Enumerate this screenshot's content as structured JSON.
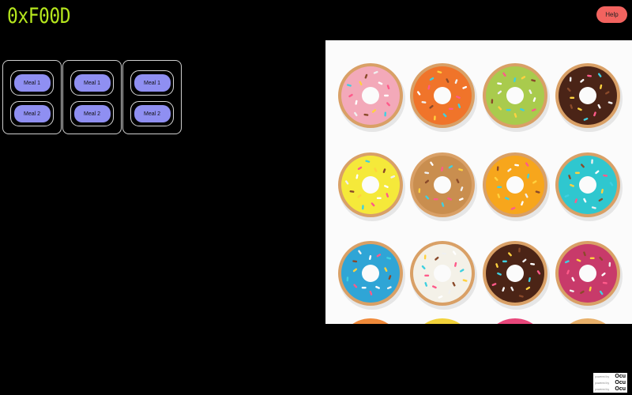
{
  "header": {
    "brand": "0xF00D",
    "help_label": "Help"
  },
  "meal_panels": [
    {
      "meals": [
        "Meal 1",
        "Meal 2"
      ]
    },
    {
      "meals": [
        "Meal 1",
        "Meal 2"
      ]
    },
    {
      "meals": [
        "Meal 1",
        "Meal 2"
      ]
    }
  ],
  "photo": {
    "subject": "donuts-photo",
    "donut_colors": [
      [
        "#f3a9b9",
        "#f0742a",
        "#a9cb4d",
        "#4a2417"
      ],
      [
        "#f5e93a",
        "#c98e4f",
        "#f7a61c",
        "#2fc7cf"
      ],
      [
        "#2fa5d6",
        "#f4f1e8",
        "#4b2416",
        "#c83a6a"
      ]
    ]
  },
  "credit": {
    "lines": [
      "powered by",
      "powered by",
      "powered by"
    ],
    "logo": "Ocu"
  },
  "colors": {
    "brand": "#b5e61d",
    "help_button": "#f2635f",
    "meal_button": "#8f8ff2",
    "background": "#000000"
  }
}
